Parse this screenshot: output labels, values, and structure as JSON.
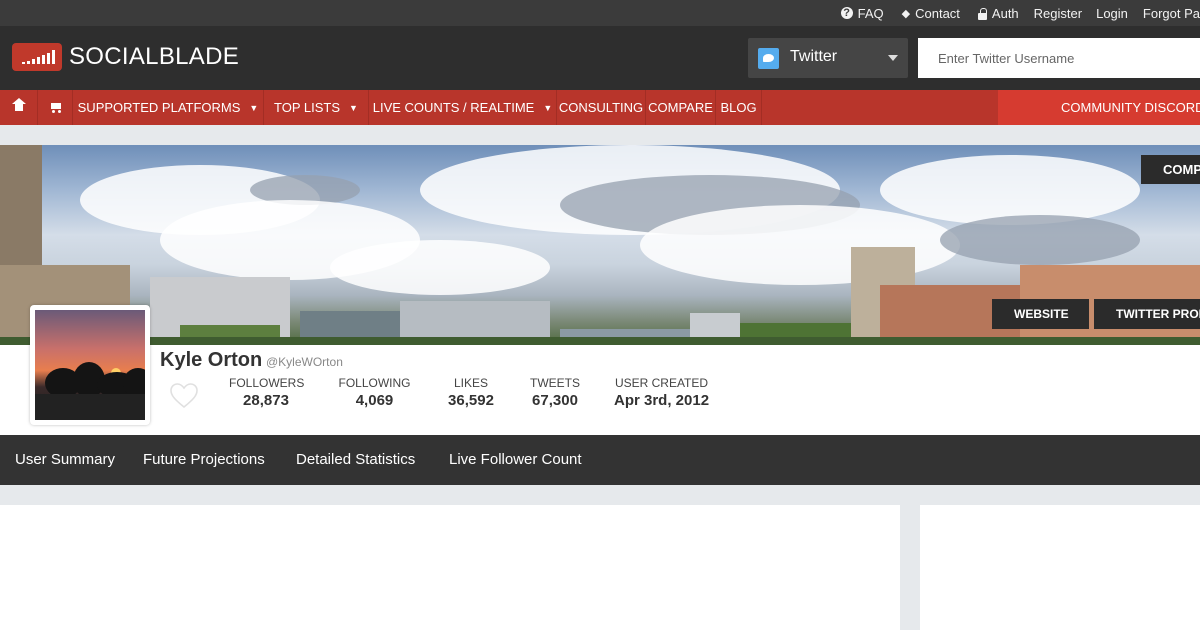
{
  "topbar": {
    "links": [
      {
        "label": "FAQ",
        "icon": "question-circle-icon"
      },
      {
        "label": "Contact",
        "icon": "eraser-icon"
      },
      {
        "label": "Auth",
        "icon": "lock-icon"
      },
      {
        "label": "Register"
      },
      {
        "label": "Login"
      },
      {
        "label": "Forgot Pa"
      }
    ]
  },
  "header": {
    "logo_text": "SOCIALBLADE",
    "platform_label": "Twitter",
    "search_placeholder": "Enter Twitter Username"
  },
  "nav": {
    "items": [
      {
        "label": "SUPPORTED PLATFORMS",
        "dropdown": true
      },
      {
        "label": "TOP LISTS",
        "dropdown": true
      },
      {
        "label": "LIVE COUNTS / REALTIME",
        "dropdown": true
      },
      {
        "label": "CONSULTING"
      },
      {
        "label": "COMPARE"
      },
      {
        "label": "BLOG"
      }
    ],
    "arrow": "▼",
    "community": "COMMUNITY DISCORD"
  },
  "banner": {
    "compare_label": "COMP",
    "website_label": "WEBSITE",
    "profile_label": "TWITTER PROF"
  },
  "profile": {
    "name": "Kyle Orton",
    "handle": "@KyleWOrton",
    "stats": [
      {
        "label": "FOLLOWERS",
        "value": "28,873"
      },
      {
        "label": "FOLLOWING",
        "value": "4,069"
      },
      {
        "label": "LIKES",
        "value": "36,592"
      },
      {
        "label": "TWEETS",
        "value": "67,300"
      },
      {
        "label": "USER CREATED",
        "value": "Apr 3rd, 2012"
      }
    ]
  },
  "tabs": [
    "User Summary",
    "Future Projections",
    "Detailed Statistics",
    "Live Follower Count"
  ],
  "colors": {
    "brand_red": "#b8352b",
    "discord_red": "#d63b30",
    "dark": "#2e2e2e",
    "twitter_blue": "#55acee"
  }
}
